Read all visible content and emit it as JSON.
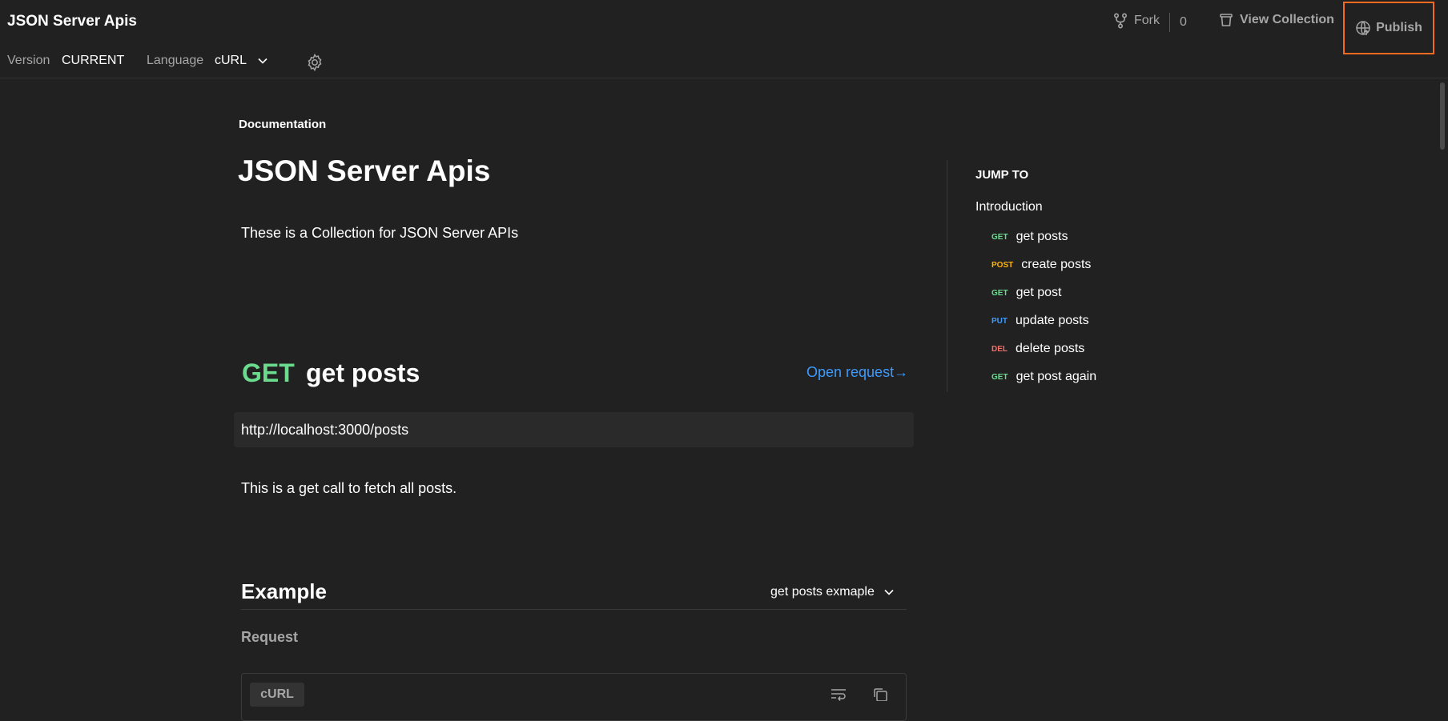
{
  "header": {
    "title": "JSON Server Apis",
    "fork_label": "Fork",
    "fork_count": "0",
    "view_collection_label": "View Collection",
    "publish_label": "Publish",
    "version_label": "Version",
    "version_value": "CURRENT",
    "language_label": "Language",
    "language_value": "cURL"
  },
  "doc": {
    "section_label": "Documentation",
    "title": "JSON Server Apis",
    "description": "These is a Collection for JSON Server APIs"
  },
  "request": {
    "method": "GET",
    "name": "get posts",
    "open_request_label": "Open request→",
    "url": "http://localhost:3000/posts",
    "description": "This is a get call to fetch all posts."
  },
  "example": {
    "title": "Example",
    "selected": "get posts exmaple",
    "request_label": "Request",
    "code_tab": "cURL"
  },
  "jump_to": {
    "title": "JUMP TO",
    "intro": "Introduction",
    "items": [
      {
        "method": "GET",
        "label": "get posts"
      },
      {
        "method": "POST",
        "label": "create posts"
      },
      {
        "method": "GET",
        "label": "get post"
      },
      {
        "method": "PUT",
        "label": "update posts"
      },
      {
        "method": "DEL",
        "label": "delete posts"
      },
      {
        "method": "GET",
        "label": "get post again"
      }
    ]
  },
  "colors": {
    "background": "#212121",
    "get": "#6bdb8e",
    "post": "#ffb400",
    "put": "#3d9bff",
    "delete": "#f0716b",
    "link": "#3d9bff",
    "publish_highlight": "#f26b21"
  },
  "icons": {
    "fork": "fork-icon",
    "view_collection": "trash-bin-icon",
    "publish": "globe-upload-icon",
    "settings": "gear-icon",
    "chevron": "chevron-down-icon",
    "wrap": "wrap-lines-icon",
    "copy": "copy-icon"
  }
}
